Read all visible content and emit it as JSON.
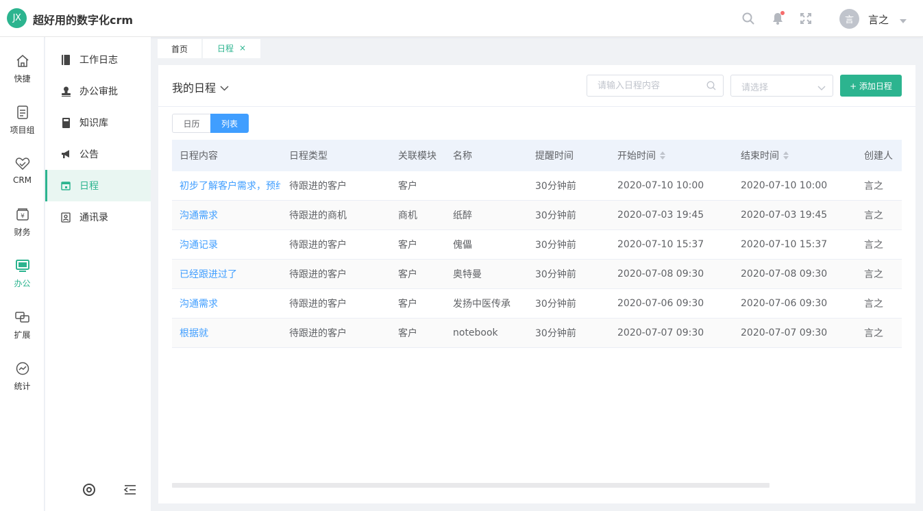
{
  "header": {
    "logo_text": "JX",
    "app_title": "超好用的数字化crm",
    "user_avatar": "言",
    "user_name": "言之"
  },
  "rail": [
    {
      "label": "快捷",
      "icon": "home-icon"
    },
    {
      "label": "项目组",
      "icon": "document-icon"
    },
    {
      "label": "CRM",
      "icon": "heart-handshake-icon"
    },
    {
      "label": "财务",
      "icon": "finance-icon"
    },
    {
      "label": "办公",
      "icon": "monitor-icon",
      "active": true
    },
    {
      "label": "扩展",
      "icon": "extend-icon"
    },
    {
      "label": "统计",
      "icon": "chart-icon"
    }
  ],
  "subnav": [
    {
      "label": "工作日志",
      "icon": "notebook-icon"
    },
    {
      "label": "办公审批",
      "icon": "stamp-icon"
    },
    {
      "label": "知识库",
      "icon": "book-icon"
    },
    {
      "label": "公告",
      "icon": "megaphone-icon"
    },
    {
      "label": "日程",
      "icon": "calendar-icon",
      "active": true
    },
    {
      "label": "通讯录",
      "icon": "contacts-icon"
    }
  ],
  "tabs": [
    {
      "label": "首页"
    },
    {
      "label": "日程",
      "close": "×"
    }
  ],
  "toolbar": {
    "title": "我的日程",
    "search_placeholder": "请输入日程内容",
    "select_placeholder": "请选择",
    "add_label": "+ 添加日程"
  },
  "view_toggle": {
    "calendar": "日历",
    "list": "列表"
  },
  "table": {
    "headers": [
      "日程内容",
      "日程类型",
      "关联模块",
      "名称",
      "提醒时间",
      "开始时间",
      "结束时间",
      "创建人"
    ],
    "rows": [
      [
        "初步了解客户需求，预约",
        "待跟进的客户",
        "客户",
        "",
        "30分钟前",
        "2020-07-10 10:00",
        "2020-07-10 10:00",
        "言之"
      ],
      [
        "沟通需求",
        "待跟进的商机",
        "商机",
        "纸醉",
        "30分钟前",
        "2020-07-03 19:45",
        "2020-07-03 19:45",
        "言之"
      ],
      [
        "沟通记录",
        "待跟进的客户",
        "客户",
        "傀儡",
        "30分钟前",
        "2020-07-10 15:37",
        "2020-07-10 15:37",
        "言之"
      ],
      [
        "已经跟进过了",
        "待跟进的客户",
        "客户",
        "奥特曼",
        "30分钟前",
        "2020-07-08 09:30",
        "2020-07-08 09:30",
        "言之"
      ],
      [
        "沟通需求",
        "待跟进的客户",
        "客户",
        "发扬中医传承",
        "30分钟前",
        "2020-07-06 09:30",
        "2020-07-06 09:30",
        "言之"
      ],
      [
        "根据就",
        "待跟进的客户",
        "客户",
        "notebook",
        "30分钟前",
        "2020-07-07 09:30",
        "2020-07-07 09:30",
        "言之"
      ]
    ]
  },
  "colors": {
    "brand": "#2cb48f",
    "link": "#409eff",
    "badge": "#f56c6c"
  }
}
